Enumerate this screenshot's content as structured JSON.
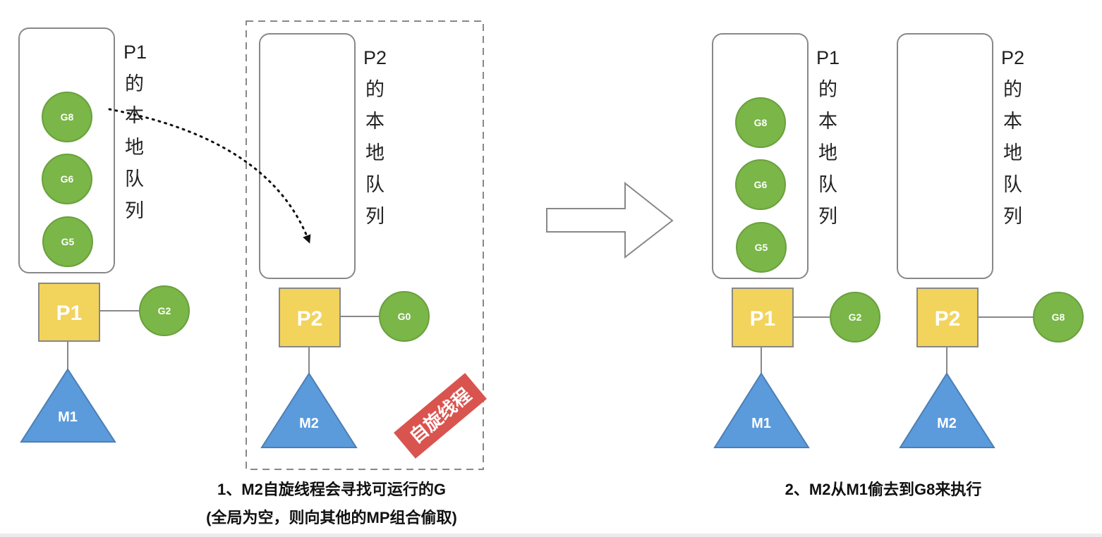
{
  "colors": {
    "goroutine": "#7ab648",
    "processor": "#f2d35c",
    "machine": "#5b9bdc",
    "spin_badge": "#d9544f",
    "outline": "#888888"
  },
  "step1": {
    "p1_queue_label": [
      "P1",
      "的",
      "本",
      "地",
      "队",
      "列"
    ],
    "p2_queue_label": [
      "P2",
      "的",
      "本",
      "地",
      "队",
      "列"
    ],
    "p1_queue_goroutines": [
      "G8",
      "G6",
      "G5"
    ],
    "p1_label": "P1",
    "p1_running": "G2",
    "m1_label": "M1",
    "p2_label": "P2",
    "p2_running": "G0",
    "m2_label": "M2",
    "spin_badge": "自旋线程",
    "caption_line1": "1、M2自旋线程会寻找可运行的G",
    "caption_line2": "(全局为空，则向其他的MP组合偷取)"
  },
  "step2": {
    "p1_queue_label": [
      "P1",
      "的",
      "本",
      "地",
      "队",
      "列"
    ],
    "p2_queue_label": [
      "P2",
      "的",
      "本",
      "地",
      "队",
      "列"
    ],
    "p1_queue_goroutines": [
      "G8",
      "G6",
      "G5"
    ],
    "p1_label": "P1",
    "p1_running": "G2",
    "m1_label": "M1",
    "p2_label": "P2",
    "p2_running": "G8",
    "m2_label": "M2",
    "caption": "2、M2从M1偷去到G8来执行"
  },
  "transition_arrow": "right-arrow-icon"
}
